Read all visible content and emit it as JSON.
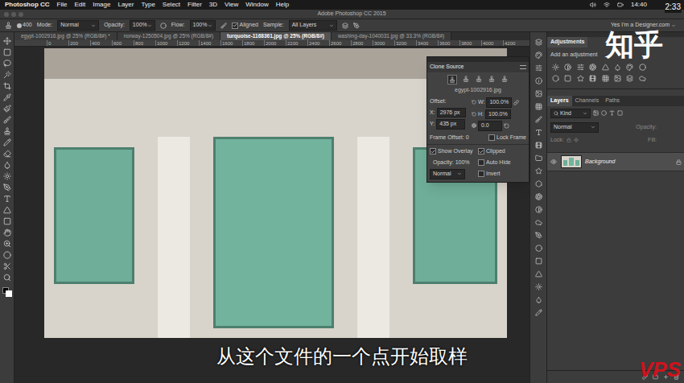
{
  "menubar": {
    "app": "Photoshop CC",
    "menus": [
      "File",
      "Edit",
      "Image",
      "Layer",
      "Type",
      "Select",
      "Filter",
      "3D",
      "View",
      "Window",
      "Help"
    ],
    "clock": "14:40"
  },
  "window": {
    "title": "Adobe Photoshop CC 2015"
  },
  "options_bar": {
    "brush_size": "400",
    "mode_label": "Mode:",
    "mode": "Normal",
    "opacity_label": "Opacity:",
    "opacity": "100%",
    "flow_label": "Flow:",
    "flow": "100%",
    "aligned": {
      "label": "Aligned",
      "checked": true
    },
    "sample_label": "Sample:",
    "sample": "All Layers",
    "workspace": "Yes I'm a Designer.com"
  },
  "tabs": [
    {
      "label": "egypt-1002916.jpg @ 25% (RGB/8#) *",
      "selected": false
    },
    {
      "label": "norway-1250504.jpg @ 25% (RGB/8#)",
      "selected": false
    },
    {
      "label": "turquoise-1168361.jpg @ 25% (RGB/8#)",
      "selected": true
    },
    {
      "label": "washing-day-1040031.jpg @ 33.3% (RGB/8#)",
      "selected": false
    }
  ],
  "ruler": [
    "0",
    "200",
    "400",
    "600",
    "800",
    "1000",
    "1200",
    "1400",
    "1600",
    "1800",
    "2000",
    "2200",
    "2400",
    "2600",
    "2800",
    "3000",
    "3200",
    "3400",
    "3600",
    "3800",
    "4000",
    "4200"
  ],
  "clone_source": {
    "title": "Clone Source",
    "sources": [
      {
        "selected": true
      },
      {
        "selected": false
      },
      {
        "selected": false
      },
      {
        "selected": false
      },
      {
        "selected": false
      }
    ],
    "source_file": "egypt-1002916.jpg",
    "offset_label": "Offset:",
    "x_label": "X:",
    "x": "2976 px",
    "y_label": "Y:",
    "y": "435 px",
    "w_label": "W:",
    "w": "100.0%",
    "h_label": "H:",
    "h": "100.0%",
    "angle": "0.0",
    "frame_offset_label": "Frame Offset:",
    "frame_offset": "0",
    "lock_frame": {
      "label": "Lock Frame",
      "checked": false
    },
    "show_overlay": {
      "label": "Show Overlay",
      "checked": true
    },
    "clipped": {
      "label": "Clipped",
      "checked": true
    },
    "auto_hide": {
      "label": "Auto Hide",
      "checked": false
    },
    "invert": {
      "label": "Invert",
      "checked": false
    },
    "opacity_label": "Opacity:",
    "opacity": "100%",
    "blend": "Normal"
  },
  "adjustments": {
    "title": "Adjustments",
    "hint": "Add an adjustment"
  },
  "layers_panel": {
    "tabs": [
      {
        "label": "Layers",
        "selected": true
      },
      {
        "label": "Channels",
        "selected": false
      },
      {
        "label": "Paths",
        "selected": false
      }
    ],
    "filter": "Kind",
    "blend": "Normal",
    "opacity_label": "Opacity:",
    "lock_label": "Lock:",
    "fill_label": "Fill:",
    "layers": [
      {
        "name": "Background",
        "visible": true,
        "locked": true
      }
    ]
  },
  "overlays": {
    "watermark": "知乎",
    "video_time": "2:33",
    "subtitle": "从这个文件的一个点开始取样",
    "logo": "VPS"
  }
}
